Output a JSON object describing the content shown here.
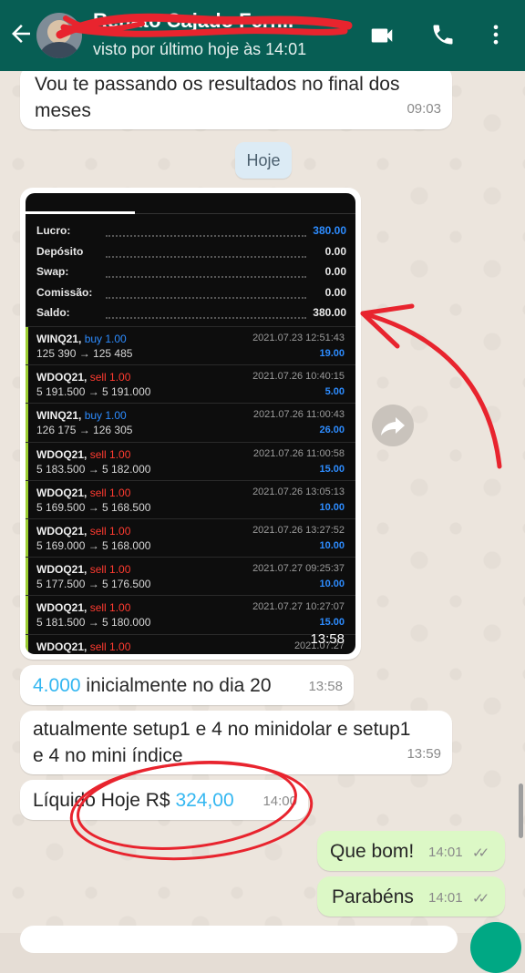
{
  "header": {
    "contact_name": "Renato Cajado Ferr...",
    "last_seen": "visto por último hoje às 14:01",
    "back_icon": "arrow-left-icon",
    "video_icon": "videocam-icon",
    "call_icon": "phone-icon",
    "menu_icon": "more-vert-icon"
  },
  "messages": {
    "m1": {
      "text_line1": "Vou te passando os resultados no final dos",
      "text_line2": "meses",
      "time": "09:03"
    },
    "date_chip": "Hoje",
    "image_time": "13:58",
    "m3": {
      "value": "4.000",
      "text": " inicialmente no dia 20",
      "time": "13:58"
    },
    "m4": {
      "text_line1": "atualmente setup1 e 4 no minidolar e setup1",
      "text_line2": "e 4 no mini índice",
      "time": "13:59"
    },
    "m5": {
      "prefix": "Líquido Hoje R$ ",
      "value": "324,00",
      "time": "14:00"
    },
    "m6": {
      "text": "Que bom!",
      "time": "14:01"
    },
    "m7": {
      "text": "Parabéns",
      "time": "14:01"
    }
  },
  "statement": {
    "summary": [
      {
        "label": "Lucro:",
        "value": "380.00",
        "accent": true
      },
      {
        "label": "Depósito",
        "value": "0.00",
        "accent": false
      },
      {
        "label": "Swap:",
        "value": "0.00",
        "accent": false
      },
      {
        "label": "Comissão:",
        "value": "0.00",
        "accent": false
      },
      {
        "label": "Saldo:",
        "value": "380.00",
        "accent": false
      }
    ],
    "trades": [
      {
        "symbol": "WINQ21,",
        "side": "buy 1.00",
        "dir": "buy",
        "prices": "125 390 → 125 485",
        "datetime": "2021.07.23 12:51:43",
        "profit": "19.00"
      },
      {
        "symbol": "WDOQ21,",
        "side": "sell 1.00",
        "dir": "sell",
        "prices": "5 191.500 → 5 191.000",
        "datetime": "2021.07.26 10:40:15",
        "profit": "5.00"
      },
      {
        "symbol": "WINQ21,",
        "side": "buy 1.00",
        "dir": "buy",
        "prices": "126 175 → 126 305",
        "datetime": "2021.07.26 11:00:43",
        "profit": "26.00"
      },
      {
        "symbol": "WDOQ21,",
        "side": "sell 1.00",
        "dir": "sell",
        "prices": "5 183.500 → 5 182.000",
        "datetime": "2021.07.26 11:00:58",
        "profit": "15.00"
      },
      {
        "symbol": "WDOQ21,",
        "side": "sell 1.00",
        "dir": "sell",
        "prices": "5 169.500 → 5 168.500",
        "datetime": "2021.07.26 13:05:13",
        "profit": "10.00"
      },
      {
        "symbol": "WDOQ21,",
        "side": "sell 1.00",
        "dir": "sell",
        "prices": "5 169.000 → 5 168.000",
        "datetime": "2021.07.26 13:27:52",
        "profit": "10.00"
      },
      {
        "symbol": "WDOQ21,",
        "side": "sell 1.00",
        "dir": "sell",
        "prices": "5 177.500 → 5 176.500",
        "datetime": "2021.07.27 09:25:37",
        "profit": "10.00"
      },
      {
        "symbol": "WDOQ21,",
        "side": "sell 1.00",
        "dir": "sell",
        "prices": "5 181.500 → 5 180.000",
        "datetime": "2021.07.27 10:27:07",
        "profit": "15.00"
      },
      {
        "symbol": "WDOQ21,",
        "side": "sell 1.00",
        "dir": "sell",
        "prices": "",
        "datetime": "2021.07.27",
        "profit": ""
      }
    ]
  },
  "colors": {
    "header": "#075e54",
    "outgoing": "#dcf8c6",
    "link_blue": "#34b7f1",
    "annotation_red": "#e8242e"
  }
}
